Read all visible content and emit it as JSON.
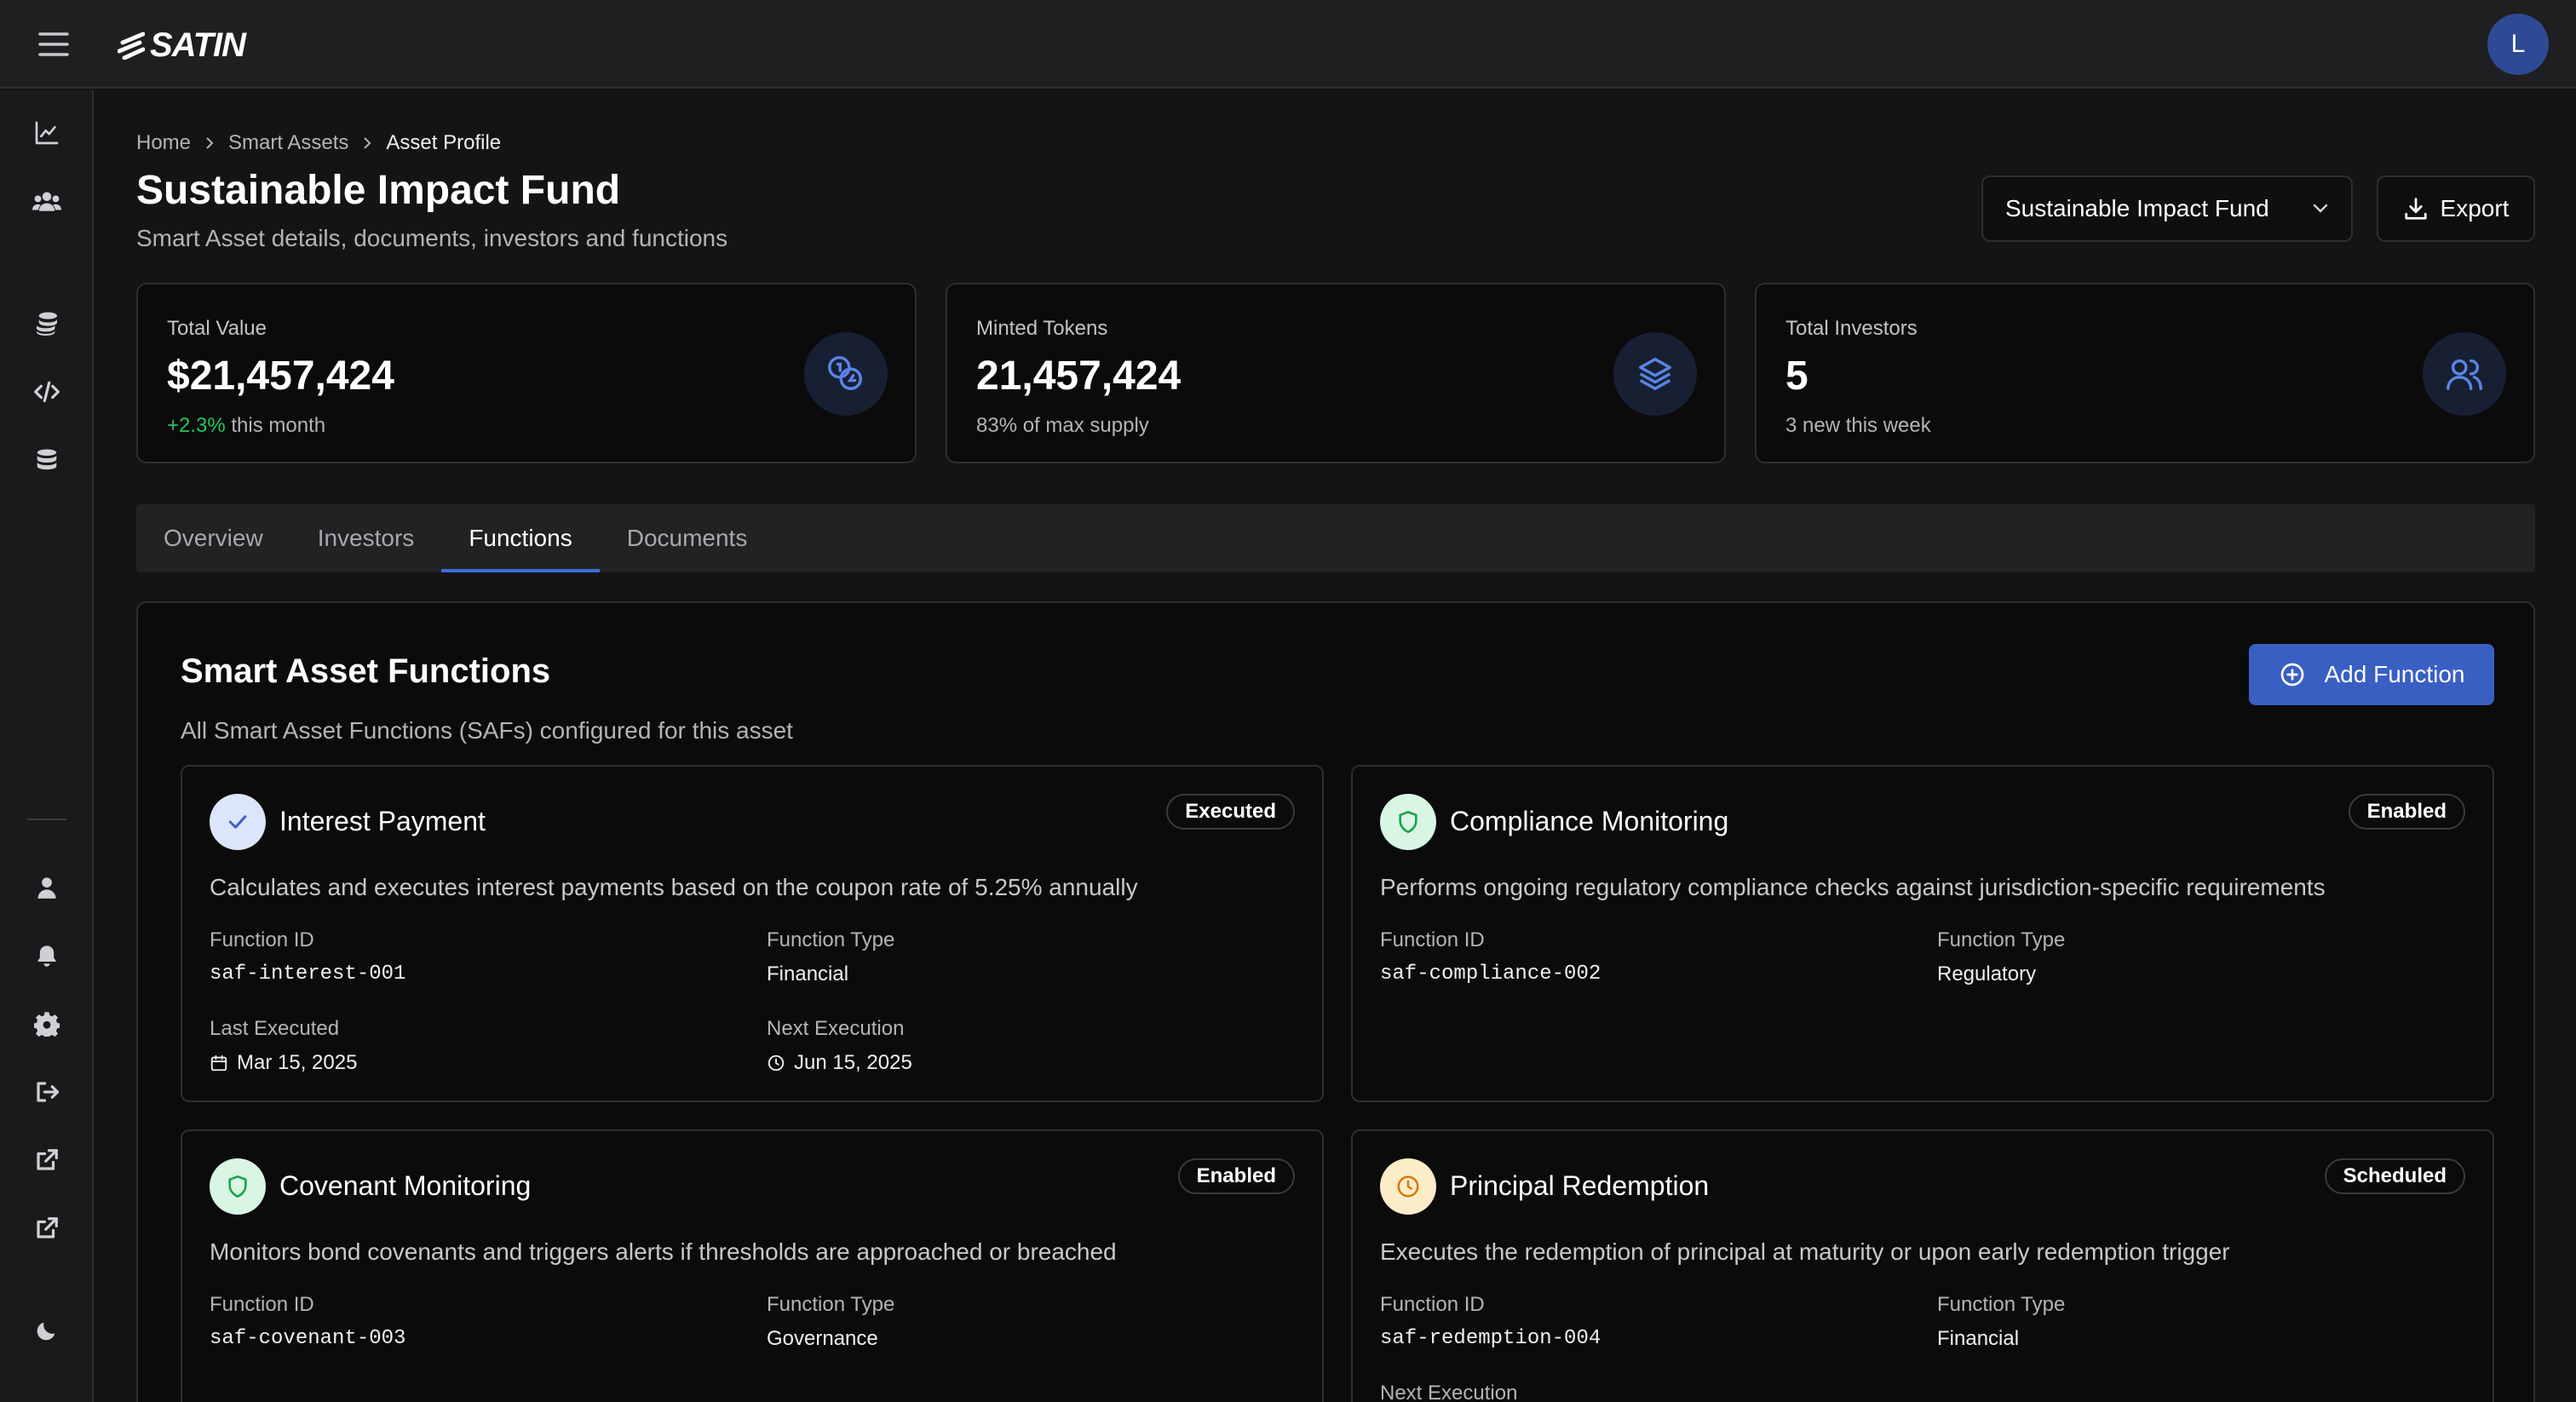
{
  "app": {
    "logo_text": "SATIN",
    "user_initial": "L"
  },
  "breadcrumb": [
    "Home",
    "Smart Assets",
    "Asset Profile"
  ],
  "page": {
    "title": "Sustainable Impact Fund",
    "subtitle": "Smart Asset details, documents, investors and functions",
    "asset_selector": "Sustainable Impact Fund",
    "export_label": "Export"
  },
  "stats": [
    {
      "label": "Total Value",
      "value": "$21,457,424",
      "note_highlight": "+2.3%",
      "note": " this month",
      "icon": "coins-icon"
    },
    {
      "label": "Minted Tokens",
      "value": "21,457,424",
      "note_highlight": "",
      "note": "83% of max supply",
      "icon": "layers-icon"
    },
    {
      "label": "Total Investors",
      "value": "5",
      "note_highlight": "",
      "note": "3 new this week",
      "icon": "users-icon"
    }
  ],
  "tabs": [
    {
      "label": "Overview",
      "active": false
    },
    {
      "label": "Investors",
      "active": false
    },
    {
      "label": "Functions",
      "active": true
    },
    {
      "label": "Documents",
      "active": false
    }
  ],
  "functions_panel": {
    "title": "Smart Asset Functions",
    "subtitle": "All Smart Asset Functions (SAFs) configured for this asset",
    "add_label": "Add Function"
  },
  "function_cards": [
    {
      "name": "Interest Payment",
      "status": "Executed",
      "icon": "check-icon",
      "description": "Calculates and executes interest payments based on the coupon rate of 5.25% annually",
      "id_label": "Function ID",
      "id": "saf-interest-001",
      "type_label": "Function Type",
      "type": "Financial",
      "last_label": "Last Executed",
      "last": "Mar 15, 2025",
      "next_label": "Next Execution",
      "next": "Jun 15, 2025"
    },
    {
      "name": "Compliance Monitoring",
      "status": "Enabled",
      "icon": "shield-icon",
      "description": "Performs ongoing regulatory compliance checks against jurisdiction-specific requirements",
      "id_label": "Function ID",
      "id": "saf-compliance-002",
      "type_label": "Function Type",
      "type": "Regulatory"
    },
    {
      "name": "Covenant Monitoring",
      "status": "Enabled",
      "icon": "shield-icon",
      "description": "Monitors bond covenants and triggers alerts if thresholds are approached or breached",
      "id_label": "Function ID",
      "id": "saf-covenant-003",
      "type_label": "Function Type",
      "type": "Governance"
    },
    {
      "name": "Principal Redemption",
      "status": "Scheduled",
      "icon": "clock-icon",
      "description": "Executes the redemption of principal at maturity or upon early redemption trigger",
      "id_label": "Function ID",
      "id": "saf-redemption-004",
      "type_label": "Function Type",
      "type": "Financial",
      "next_label": "Next Execution"
    }
  ],
  "colors": {
    "accent": "#3a5fc3",
    "positive": "#22c55e",
    "background": "#141415",
    "card": "#0b0b0c"
  }
}
